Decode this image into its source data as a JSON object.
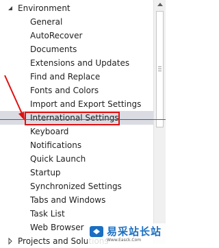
{
  "tree": {
    "environment": {
      "label": "Environment"
    },
    "items": [
      {
        "label": "General"
      },
      {
        "label": "AutoRecover"
      },
      {
        "label": "Documents"
      },
      {
        "label": "Extensions and Updates"
      },
      {
        "label": "Find and Replace"
      },
      {
        "label": "Fonts and Colors"
      },
      {
        "label": "Import and Export Settings"
      },
      {
        "label": "International Settings",
        "selected": true
      },
      {
        "label": "Keyboard"
      },
      {
        "label": "Notifications"
      },
      {
        "label": "Quick Launch"
      },
      {
        "label": "Startup"
      },
      {
        "label": "Synchronized Settings"
      },
      {
        "label": "Tabs and Windows"
      },
      {
        "label": "Task List"
      },
      {
        "label": "Web Browser"
      }
    ],
    "projects": {
      "label": "Projects and Solutions"
    }
  },
  "watermark": {
    "text": "易采站长站",
    "url": "Www.Easck.Com"
  },
  "colors": {
    "selection": "#dadbe3",
    "highlight": "#e01010",
    "brand": "#1b6fc2"
  }
}
